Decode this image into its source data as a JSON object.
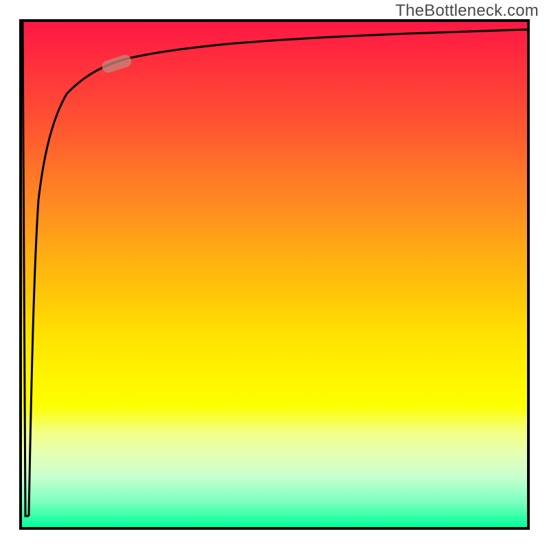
{
  "watermark": "TheBottleneck.com",
  "chart_data": {
    "type": "line",
    "title": "",
    "xlabel": "",
    "ylabel": "",
    "x_range": [
      0,
      1
    ],
    "y_range": [
      0,
      1
    ],
    "grid": false,
    "legend": false,
    "background_gradient": {
      "direction": "vertical",
      "stops": [
        {
          "pos": 0.0,
          "color": "#ff1744"
        },
        {
          "pos": 0.5,
          "color": "#ffc300"
        },
        {
          "pos": 0.8,
          "color": "#f4ff60"
        },
        {
          "pos": 1.0,
          "color": "#00ff99"
        }
      ]
    },
    "series": [
      {
        "name": "initial-dip",
        "description": "near-vertical dip at left edge",
        "x": [
          0.0,
          0.006,
          0.013
        ],
        "y": [
          1.0,
          0.02,
          1.0
        ]
      },
      {
        "name": "log-curve",
        "description": "log-like rise approaching y≈0.98",
        "x": [
          0.013,
          0.02,
          0.03,
          0.05,
          0.08,
          0.12,
          0.17,
          0.22,
          0.28,
          0.35,
          0.45,
          0.6,
          0.8,
          1.0
        ],
        "y": [
          0.02,
          0.3,
          0.52,
          0.7,
          0.8,
          0.86,
          0.895,
          0.913,
          0.928,
          0.94,
          0.952,
          0.962,
          0.972,
          0.98
        ]
      }
    ],
    "marker": {
      "shape": "rounded-rect-rotated",
      "center_x": 0.17,
      "center_y": 0.895,
      "color": "#c48479",
      "opacity": 0.78
    },
    "frame_color": "#000000"
  }
}
